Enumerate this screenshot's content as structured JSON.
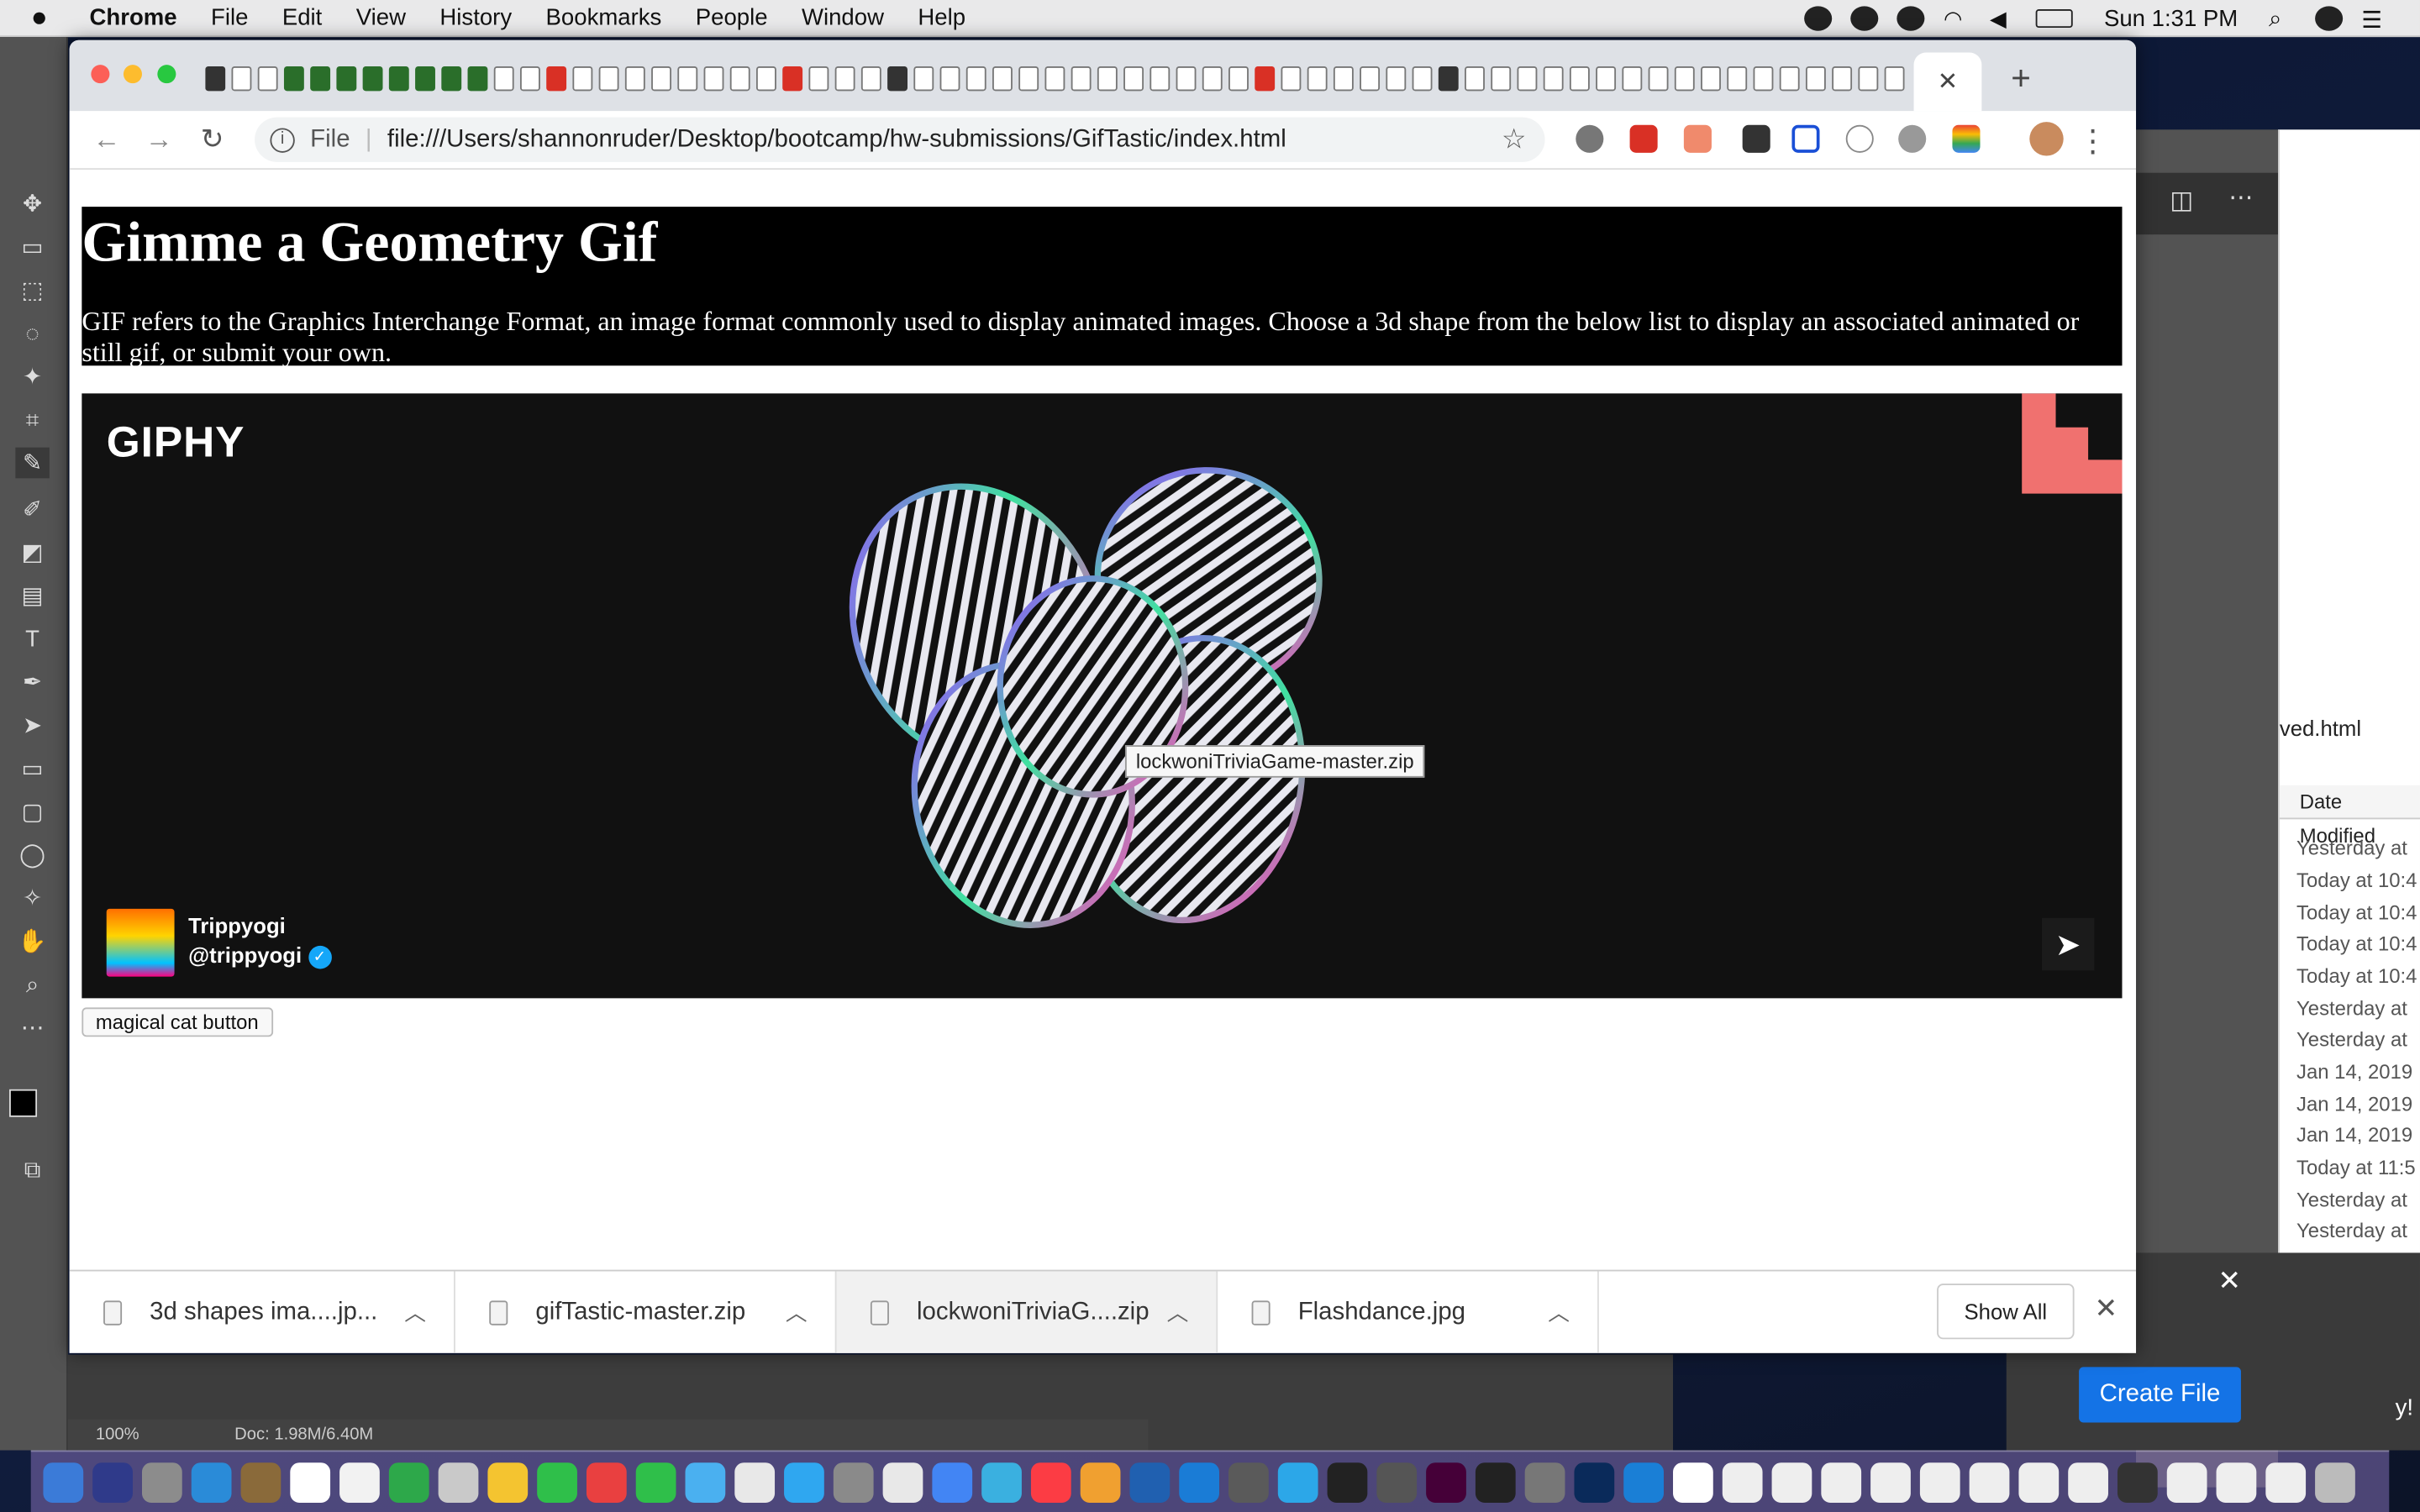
{
  "menubar": {
    "apple": "",
    "items": [
      "Chrome",
      "File",
      "Edit",
      "View",
      "History",
      "Bookmarks",
      "People",
      "Window",
      "Help"
    ],
    "clock": "Sun 1:31 PM"
  },
  "browser": {
    "close_tab": "✕",
    "new_tab": "+",
    "address": {
      "scheme_label": "File",
      "url": "file:///Users/shannonruder/Desktop/bootcamp/hw-submissions/GifTastic/index.html"
    }
  },
  "page": {
    "title": "Gimme a Geometry Gif",
    "description": "GIF refers to the Graphics Interchange Format, an image format commonly used to display animated images. Choose a 3d shape from the below list to display an associated animated or still gif, or submit your own.",
    "embed": {
      "brand": "GIPHY",
      "display_name": "Trippyogi",
      "handle": "@trippyogi",
      "tooltip": "lockwoniTriviaGame-master.zip"
    },
    "button_label": "magical cat button"
  },
  "downloads": {
    "items": [
      "3d  shapes ima....jp...",
      "gifTastic-master.zip",
      "lockwoniTriviaG....zip",
      "Flashdance.jpg"
    ],
    "show_all": "Show All"
  },
  "finder": {
    "file_suffix": "ved.html",
    "column_header": "Date Modified",
    "dates": [
      "Yesterday at",
      "Today at 10:4",
      "Today at 10:4",
      "Today at 10:4",
      "Today at 10:4",
      "Yesterday at",
      "Yesterday at",
      "Jan 14, 2019",
      "Jan 14, 2019",
      "Jan 14, 2019",
      "Today at 11:5",
      "Yesterday at",
      "Yesterday at"
    ]
  },
  "photoshop": {
    "zoom": "100%",
    "doc_info": "Doc: 1.98M/6.40M",
    "create_file": "Create File",
    "side_text": "y!"
  },
  "colors": {
    "accent_blue": "#1473e6",
    "giphy_corner": "#f0716f",
    "verified": "#15a7f9"
  }
}
